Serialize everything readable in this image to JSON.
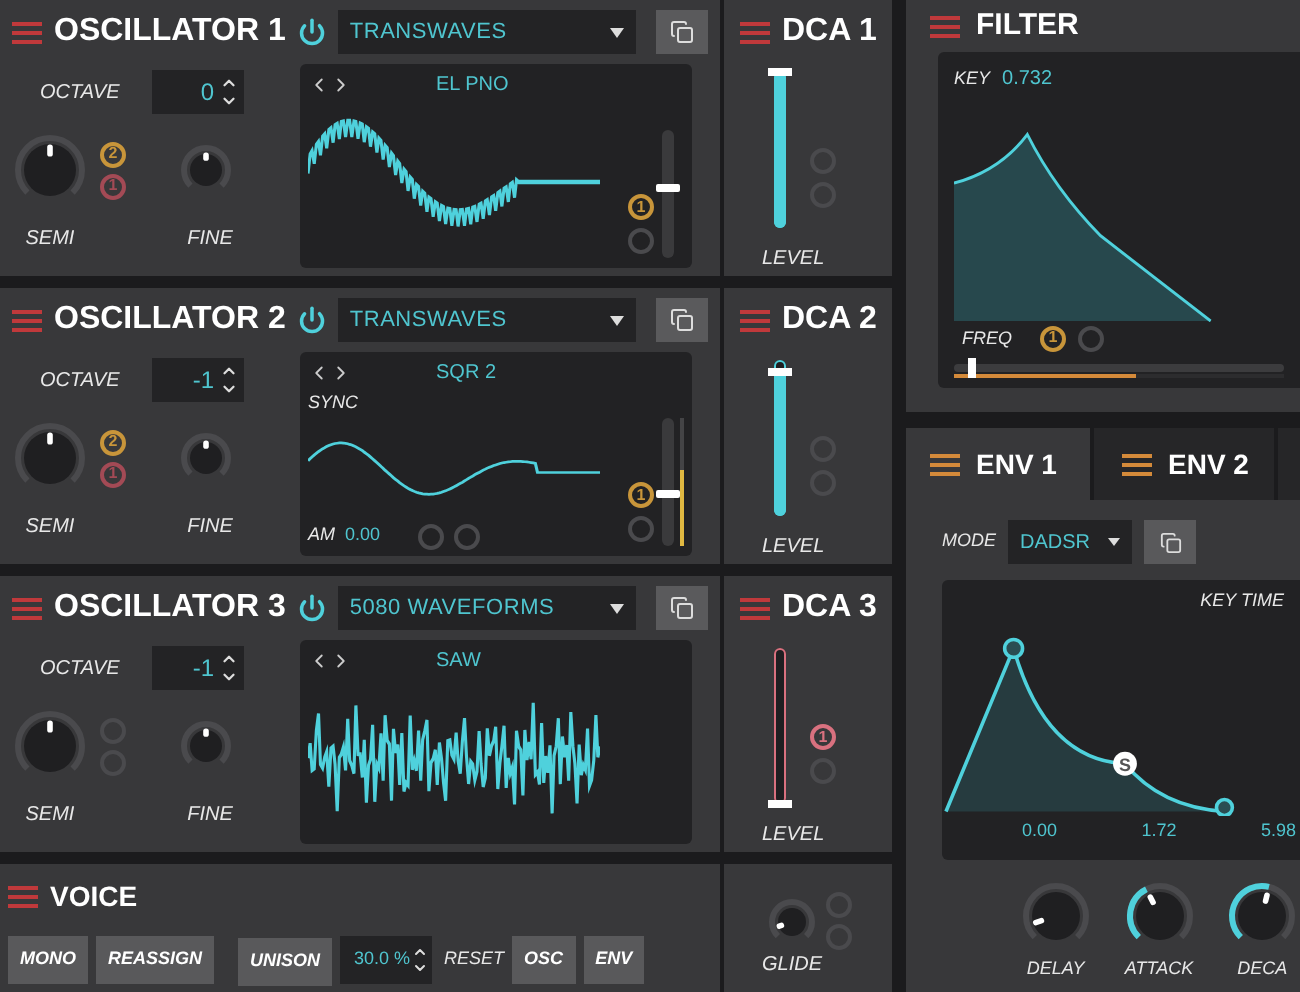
{
  "oscillators": [
    {
      "title": "OSCILLATOR 1",
      "power_on": true,
      "wavetable": "TRANSWAVES",
      "octave_label": "OCTAVE",
      "octave": "0",
      "semi": {
        "label": "SEMI",
        "level": 0.5
      },
      "fine": {
        "label": "FINE",
        "level": 0.5
      },
      "semi_mods": [
        {
          "kind": "assigned",
          "label": "2",
          "color": "#c8953a"
        },
        {
          "kind": "assigned",
          "label": "1",
          "color": "#a34a55"
        }
      ],
      "wave_name": "EL PNO",
      "kind": "decay",
      "display_mods": [
        {
          "kind": "assigned",
          "label": "1",
          "color": "#c8953a"
        },
        {
          "kind": "empty"
        }
      ],
      "slider": {
        "level": 0.55
      }
    },
    {
      "title": "OSCILLATOR 2",
      "power_on": true,
      "wavetable": "TRANSWAVES",
      "octave_label": "OCTAVE",
      "octave": "-1",
      "semi": {
        "label": "SEMI",
        "level": 0.5
      },
      "fine": {
        "label": "FINE",
        "level": 0.5
      },
      "semi_mods": [
        {
          "kind": "assigned",
          "label": "2",
          "color": "#c8953a"
        },
        {
          "kind": "assigned",
          "label": "1",
          "color": "#a34a55"
        }
      ],
      "wave_name": "SQR 2",
      "kind": "sine",
      "sync_label": "SYNC",
      "am_label": "AM",
      "am_value": "0.00",
      "am_mods": [
        {
          "kind": "empty"
        },
        {
          "kind": "empty"
        }
      ],
      "display_mods": [
        {
          "kind": "assigned",
          "label": "1",
          "color": "#c8953a"
        },
        {
          "kind": "empty"
        }
      ],
      "slider": {
        "level": 0.4
      },
      "slider_mod": {
        "level": 0.6
      }
    },
    {
      "title": "OSCILLATOR 3",
      "power_on": true,
      "wavetable": "5080 WAVEFORMS",
      "octave_label": "OCTAVE",
      "octave": "-1",
      "semi": {
        "label": "SEMI",
        "level": 0.5
      },
      "fine": {
        "label": "FINE",
        "level": 0.5
      },
      "semi_mods": [
        {
          "kind": "empty"
        },
        {
          "kind": "empty"
        }
      ],
      "wave_name": "SAW",
      "kind": "noise"
    }
  ],
  "dcas": [
    {
      "title": "DCA 1",
      "level": 1.0,
      "color": "#4fd1dc",
      "label": "LEVEL",
      "mods": [
        {
          "kind": "empty"
        },
        {
          "kind": "empty"
        }
      ]
    },
    {
      "title": "DCA 2",
      "level": 0.92,
      "color": "#4fd1dc",
      "label": "LEVEL",
      "mods": [
        {
          "kind": "empty"
        },
        {
          "kind": "empty"
        }
      ]
    },
    {
      "title": "DCA 3",
      "level": 0.0,
      "color": "#d9717f",
      "label": "LEVEL",
      "mods": [
        {
          "kind": "assigned",
          "label": "1",
          "color": "#d9717f"
        },
        {
          "kind": "empty"
        }
      ]
    }
  ],
  "voice": {
    "title": "VOICE",
    "buttons": [
      "MONO",
      "REASSIGN"
    ],
    "unison": "UNISON",
    "unison_value": "30.0 %",
    "reset_label": "RESET",
    "reset_buttons": [
      "OSC",
      "ENV"
    ]
  },
  "glide": {
    "label": "GLIDE",
    "level": 0.1,
    "mods": [
      {
        "kind": "empty"
      },
      {
        "kind": "empty"
      }
    ]
  },
  "filter": {
    "title": "FILTER",
    "key_label": "KEY",
    "key_value": "0.732",
    "freq_label": "FREQ",
    "mods": [
      {
        "kind": "assigned",
        "label": "1",
        "color": "#c8953a"
      },
      {
        "kind": "empty"
      }
    ],
    "freq": {
      "level": 0.04
    },
    "freq_mod": {
      "level": 0.55
    }
  },
  "env": {
    "tabs": [
      {
        "label": "ENV 1",
        "selected": true
      },
      {
        "label": "ENV 2",
        "selected": false
      },
      {
        "selected": false
      }
    ],
    "mode_label": "MODE",
    "mode": "DADSR",
    "key_time_label": "KEY TIME",
    "sustain_label": "S",
    "times": [
      "0.00",
      "1.72",
      "5.98"
    ],
    "knobs": [
      {
        "label": "DELAY",
        "kind": "plain",
        "level": 0.1
      },
      {
        "label": "ATTACK",
        "kind": "arc",
        "level": 0.4
      },
      {
        "label": "DECA",
        "kind": "arc",
        "level": 0.55
      }
    ]
  }
}
